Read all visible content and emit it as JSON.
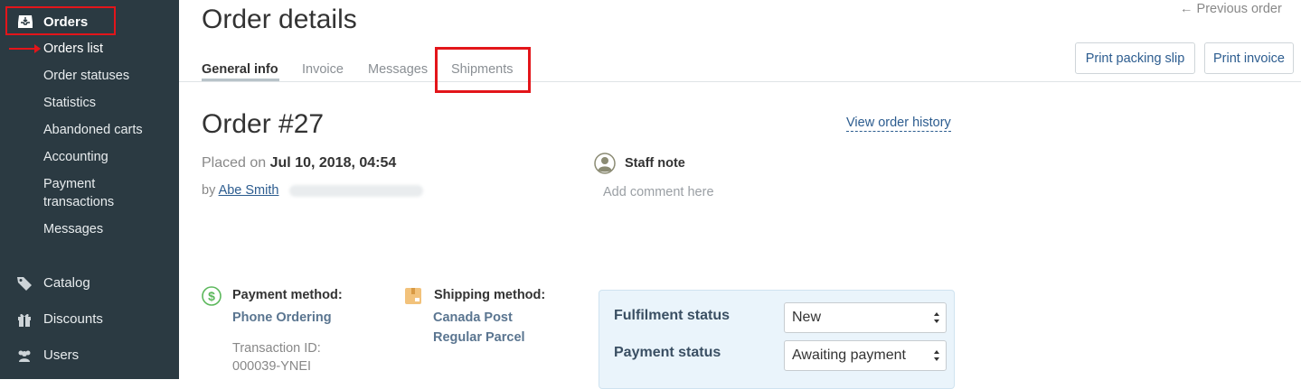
{
  "sidebar": {
    "section_title": "Orders",
    "sub_items": [
      {
        "label": "Orders list"
      },
      {
        "label": "Order statuses"
      },
      {
        "label": "Statistics"
      },
      {
        "label": "Abandoned carts"
      },
      {
        "label": "Accounting"
      },
      {
        "label": "Payment transactions"
      },
      {
        "label": "Messages"
      }
    ],
    "main_items": [
      {
        "label": "Catalog",
        "icon": "tag-icon"
      },
      {
        "label": "Discounts",
        "icon": "gift-icon"
      },
      {
        "label": "Users",
        "icon": "users-icon"
      }
    ]
  },
  "header": {
    "title": "Order details",
    "prev_order": "←  Previous order",
    "print_packing_slip": "Print packing slip",
    "print_invoice": "Print invoice"
  },
  "tabs": [
    {
      "label": "General info",
      "active": true
    },
    {
      "label": "Invoice"
    },
    {
      "label": "Messages"
    },
    {
      "label": "Shipments"
    }
  ],
  "order": {
    "title": "Order #27",
    "view_history": "View order history",
    "placed_prefix": "Placed on",
    "placed_date": "Jul 10, 2018, 04:54",
    "by_prefix": "by",
    "customer_name": "Abe Smith"
  },
  "staff_note": {
    "title": "Staff note",
    "placeholder": "Add comment here"
  },
  "payment": {
    "label": "Payment method:",
    "value": "Phone Ordering",
    "transaction_label": "Transaction ID:",
    "transaction_id": "000039-YNEI"
  },
  "shipping": {
    "label": "Shipping method:",
    "line1": "Canada Post",
    "line2": "Regular Parcel"
  },
  "statuses": {
    "fulfilment_label": "Fulfilment status",
    "fulfilment_value": "New",
    "payment_label": "Payment status",
    "payment_value": "Awaiting payment"
  },
  "colors": {
    "sidebar_bg": "#2b3a42",
    "highlight": "#e3151a",
    "link": "#2c5c8f"
  }
}
